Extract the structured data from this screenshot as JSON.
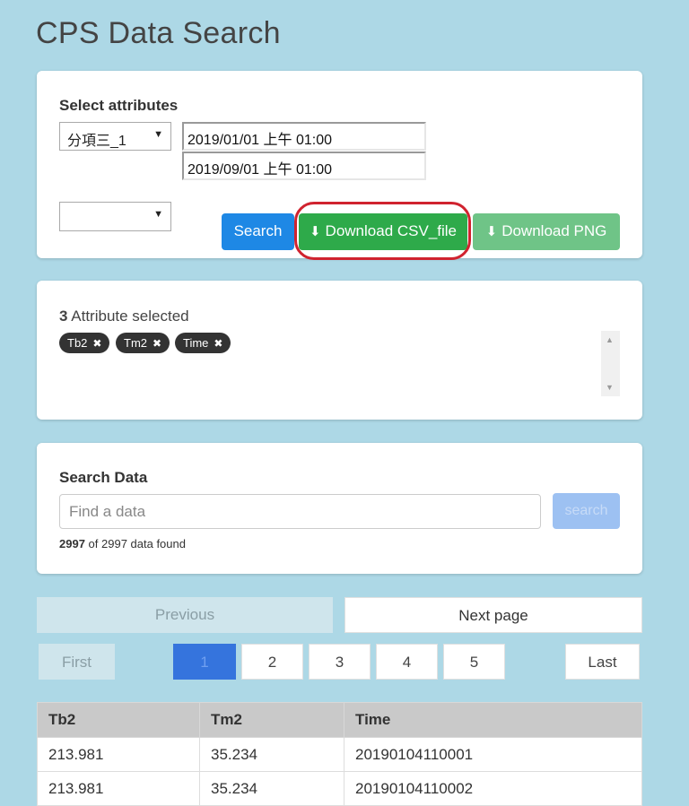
{
  "page": {
    "title": "CPS Data Search"
  },
  "attributes": {
    "heading": "Select attributes",
    "select1_value": "分項三_1",
    "select2_value": "",
    "date_start": "2019/01/01 上午 01:00",
    "date_end": "2019/09/01 上午 01:00",
    "search_label": "Search",
    "download_csv_label": "Download CSV_file",
    "download_png_label": "Download PNG"
  },
  "selected": {
    "count": "3",
    "count_suffix": "Attribute selected",
    "chips": [
      "Tb2",
      "Tm2",
      "Time"
    ]
  },
  "search": {
    "heading": "Search Data",
    "placeholder": "Find a data",
    "button_label": "search",
    "found_count": "2997",
    "found_text": "of 2997 data found"
  },
  "pager": {
    "previous": "Previous",
    "next": "Next page",
    "first": "First",
    "last": "Last",
    "pages": [
      "1",
      "2",
      "3",
      "4",
      "5"
    ],
    "current_page": "1"
  },
  "table": {
    "columns": [
      "Tb2",
      "Tm2",
      "Time"
    ],
    "rows": [
      [
        "213.981",
        "35.234",
        "20190104110001"
      ],
      [
        "213.981",
        "35.234",
        "20190104110002"
      ]
    ]
  },
  "colors": {
    "background": "#add8e6",
    "primary": "#1e88e5",
    "success": "#2eaa4a",
    "highlight": "#d0232f"
  }
}
